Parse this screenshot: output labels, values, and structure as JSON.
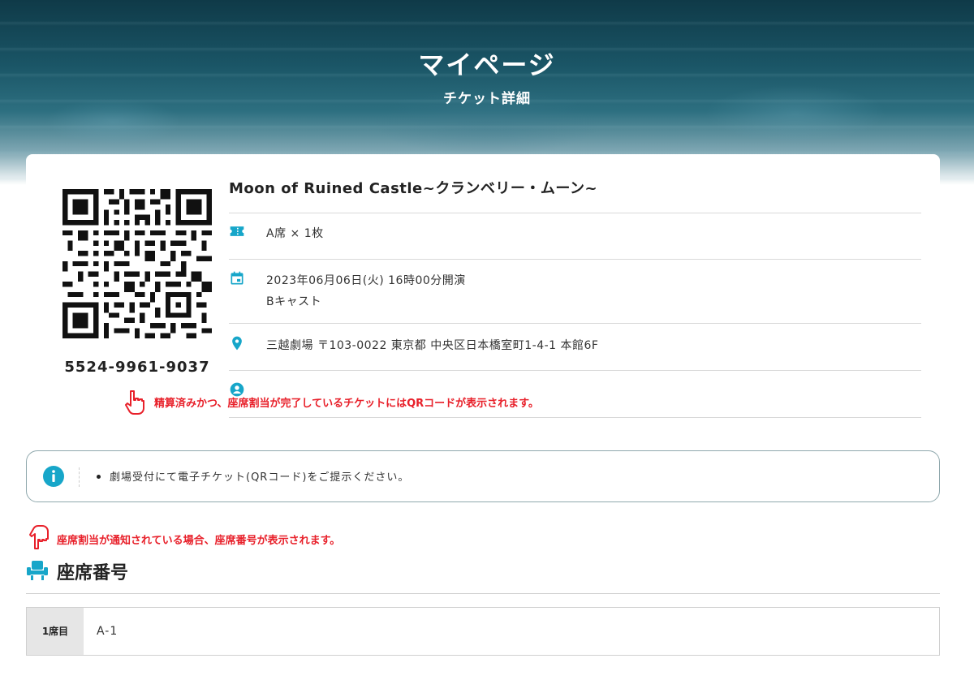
{
  "header": {
    "title": "マイページ",
    "subtitle": "チケット詳細"
  },
  "ticket": {
    "number": "5524-9961-9037",
    "event_title": "Moon of Ruined Castle~クランベリー・ムーン~",
    "seat_type": "A席 × 1枚",
    "datetime": "2023年06月06日(火) 16時00分開演",
    "cast": "Bキャスト",
    "venue": "三越劇場 〒103-0022 東京都 中央区日本橋室町1-4-1 本館6F"
  },
  "annotations": {
    "qr_note": "精算済みかつ、座席割当が完了しているチケットにはQRコードが表示されます。",
    "seat_note": "座席割当が通知されている場合、座席番号が表示されます。"
  },
  "info": {
    "items": [
      "劇場受付にて電子チケット(QRコード)をご提示ください。"
    ]
  },
  "seats": {
    "heading": "座席番号",
    "rows": [
      {
        "label": "1席目",
        "value": "A-1"
      }
    ]
  },
  "icons": {
    "ticket": "ticket-icon",
    "calendar": "calendar-icon",
    "location": "location-pin-icon",
    "person": "person-icon",
    "info": "info-icon",
    "seat": "seat-icon",
    "hand_up": "pointing-up-hand-icon",
    "hand_down": "pointing-down-hand-icon"
  },
  "colors": {
    "accent": "#17a6c9",
    "annotation_red": "#e8202a",
    "info_border": "#8fa8ad"
  }
}
